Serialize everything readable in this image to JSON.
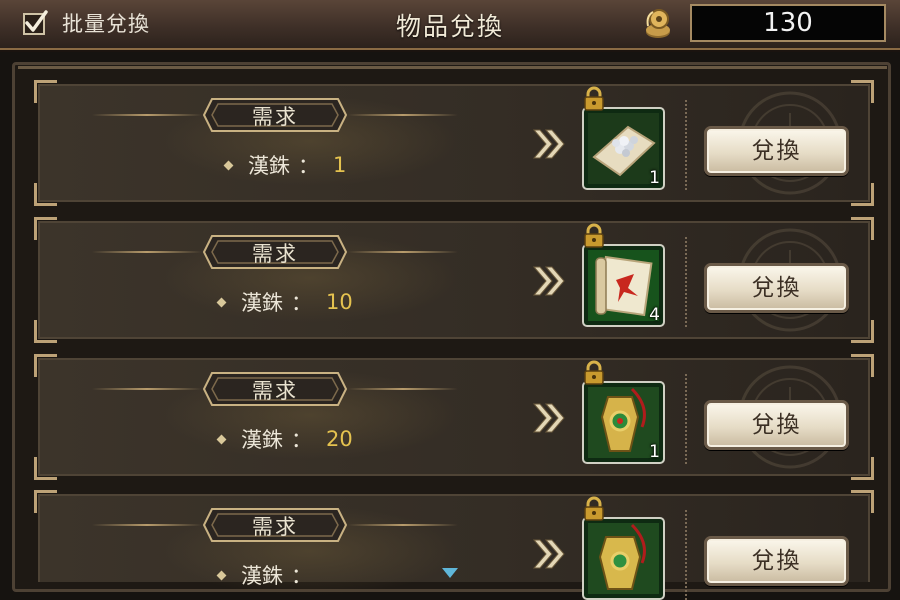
{
  "header": {
    "batch_label": "批量兌換",
    "batch_checked": true,
    "title": "物品兌換",
    "currency_icon": "coin-icon",
    "currency_amount": "130"
  },
  "rows": [
    {
      "requirement_label": "需求",
      "cost_name": "漢銖",
      "cost_colon": "：",
      "cost_value": "1",
      "item_icon": "silver-ingots-icon",
      "item_qty": "1",
      "button_label": "兌換",
      "locked": true
    },
    {
      "requirement_label": "需求",
      "cost_name": "漢銖",
      "cost_colon": "：",
      "cost_value": "10",
      "item_icon": "scroll-icon",
      "item_qty": "4",
      "button_label": "兌換",
      "locked": true
    },
    {
      "requirement_label": "需求",
      "cost_name": "漢銖",
      "cost_colon": "：",
      "cost_value": "20",
      "item_icon": "jade-pendant-icon",
      "item_qty": "1",
      "button_label": "兌換",
      "locked": true
    },
    {
      "requirement_label": "需求",
      "cost_name": "漢銖",
      "cost_colon": "：",
      "cost_value": "",
      "item_icon": "ornament-icon",
      "item_qty": "",
      "button_label": "兌換",
      "locked": true
    }
  ],
  "colors": {
    "accent_gold": "#e4c24f",
    "text_light": "#ece6d8",
    "button_face": "#efe6d2"
  }
}
